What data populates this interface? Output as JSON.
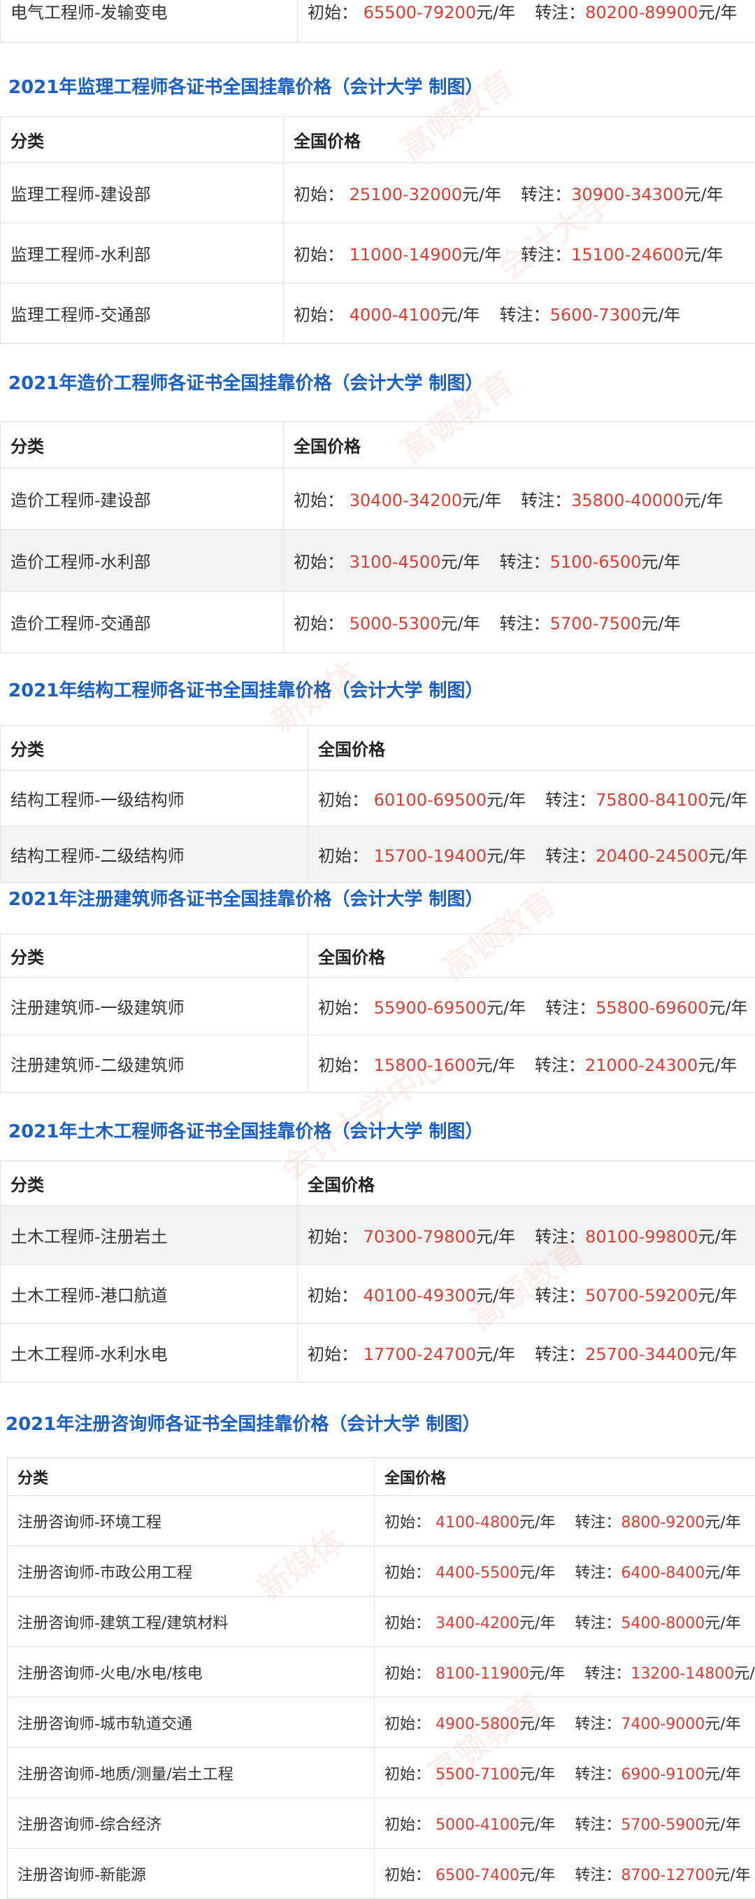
{
  "watermark": [
    "高顿教育",
    "会计大学",
    "新媒体",
    "会计大学中心"
  ],
  "top_row": {
    "category": "电气工程师-发输变电",
    "start_label": "初始：",
    "start": "65500-79200",
    "unit": "元/年",
    "transfer_label": "转注：",
    "transfer": "80200-89900",
    "unit2": "元/年"
  },
  "labels": {
    "category": "分类",
    "price": "全国价格",
    "start": "初始：",
    "transfer": "转注：",
    "unit": "元/年"
  },
  "sections": [
    {
      "title": "2021年监理工程师各证书全国挂靠价格（会计大学 制图）",
      "rows": [
        {
          "category": "监理工程师-建设部",
          "start": "25100-32000",
          "transfer": "30900-34300"
        },
        {
          "category": "监理工程师-水利部",
          "start": "11000-14900",
          "transfer": "15100-24600"
        },
        {
          "category": "监理工程师-交通部",
          "start": "4000-4100",
          "transfer": "5600-7300"
        }
      ]
    },
    {
      "title": "2021年造价工程师各证书全国挂靠价格（会计大学 制图）",
      "rows": [
        {
          "category": "造价工程师-建设部",
          "start": "30400-34200",
          "transfer": "35800-40000"
        },
        {
          "category": "造价工程师-水利部",
          "start": "3100-4500",
          "transfer": "5100-6500"
        },
        {
          "category": "造价工程师-交通部",
          "start": "5000-5300",
          "transfer": "5700-7500"
        }
      ]
    },
    {
      "title": "2021年结构工程师各证书全国挂靠价格（会计大学 制图）",
      "rows": [
        {
          "category": "结构工程师-一级结构师",
          "start": "60100-69500",
          "transfer": "75800-84100"
        },
        {
          "category": "结构工程师-二级结构师",
          "start": "15700-19400",
          "transfer": "20400-24500"
        }
      ]
    },
    {
      "title": "2021年注册建筑师各证书全国挂靠价格（会计大学 制图）",
      "rows": [
        {
          "category": "注册建筑师-一级建筑师",
          "start": "55900-69500",
          "transfer": "55800-69600"
        },
        {
          "category": "注册建筑师-二级建筑师",
          "start": "15800-1600",
          "transfer": "21000-24300"
        }
      ]
    },
    {
      "title": "2021年土木工程师各证书全国挂靠价格（会计大学 制图）",
      "rows": [
        {
          "category": "土木工程师-注册岩土",
          "start": "70300-79800",
          "transfer": "80100-99800"
        },
        {
          "category": "土木工程师-港口航道",
          "start": "40100-49300",
          "transfer": "50700-59200"
        },
        {
          "category": "土木工程师-水利水电",
          "start": "17700-24700",
          "transfer": "25700-34400"
        }
      ]
    },
    {
      "title": "2021年注册咨询师各证书全国挂靠价格（会计大学 制图）",
      "rows": [
        {
          "category": "注册咨询师-环境工程",
          "start": "4100-4800",
          "transfer": "8800-9200"
        },
        {
          "category": "注册咨询师-市政公用工程",
          "start": "4400-5500",
          "transfer": "6400-8400"
        },
        {
          "category": "注册咨询师-建筑工程/建筑材料",
          "start": "3400-4200",
          "transfer": "5400-8000"
        },
        {
          "category": "注册咨询师-火电/水电/核电",
          "start": "8100-11900",
          "transfer": "13200-14800"
        },
        {
          "category": "注册咨询师-城市轨道交通",
          "start": "4900-5800",
          "transfer": "7400-9000"
        },
        {
          "category": "注册咨询师-地质/测量/岩土工程",
          "start": "5500-7100",
          "transfer": "6900-9100"
        },
        {
          "category": "注册咨询师-综合经济",
          "start": "5000-4100",
          "transfer": "5700-5900"
        },
        {
          "category": "注册咨询师-新能源",
          "start": "6500-7400",
          "transfer": "8700-12700"
        }
      ]
    }
  ]
}
